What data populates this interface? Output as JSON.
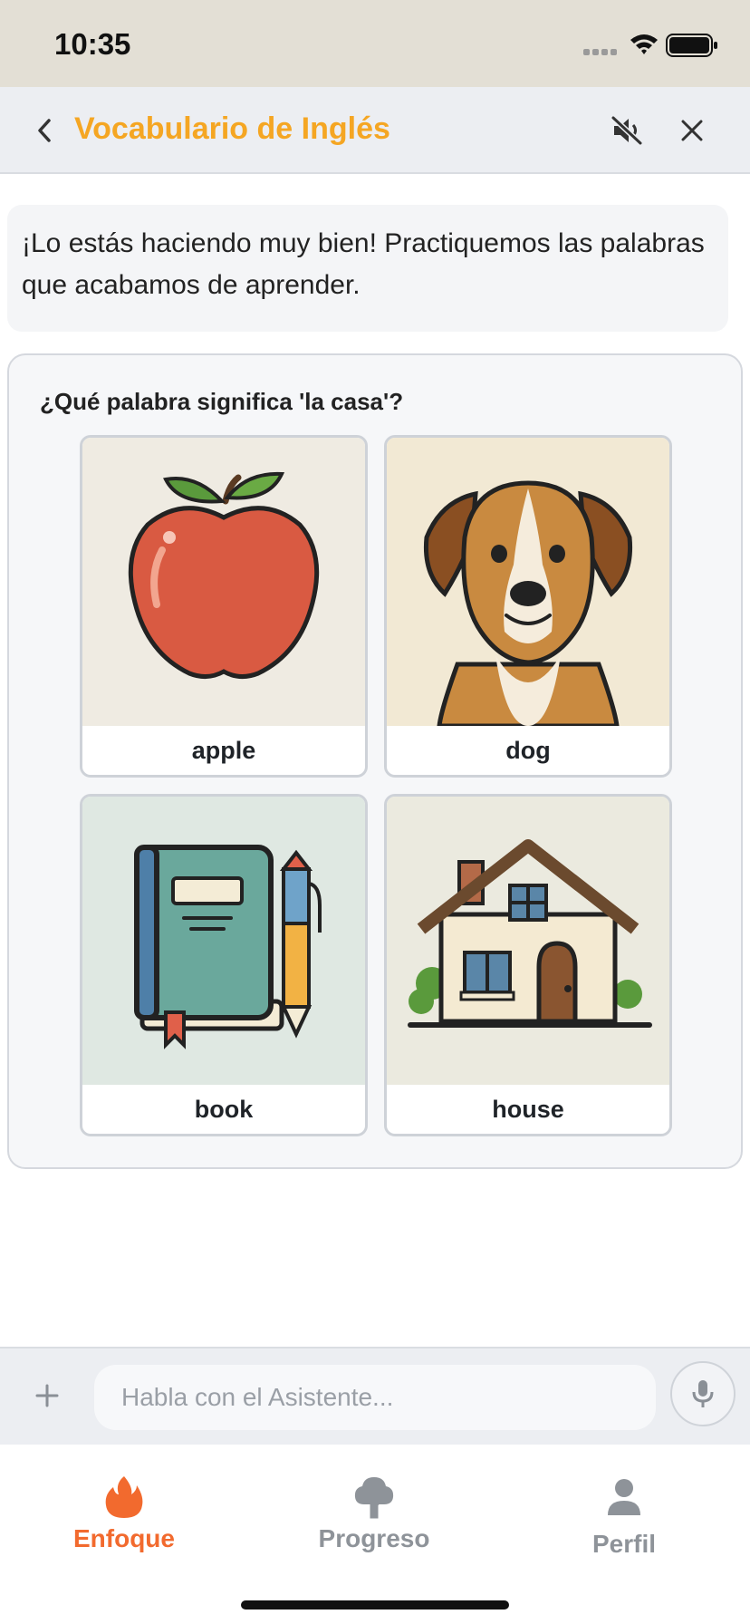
{
  "status_bar": {
    "time": "10:35"
  },
  "header": {
    "title": "Vocabulario de Inglés",
    "back_icon": "chevron-left-icon",
    "mute_icon": "speaker-muted-icon",
    "close_icon": "close-icon"
  },
  "message": {
    "text": "¡Lo estás haciendo muy bien! Practiquemos las palabras que acabamos de aprender."
  },
  "quiz": {
    "question": "¿Qué palabra significa 'la casa'?",
    "options": [
      {
        "label": "apple",
        "image": "apple-illustration"
      },
      {
        "label": "dog",
        "image": "dog-illustration"
      },
      {
        "label": "book",
        "image": "book-illustration"
      },
      {
        "label": "house",
        "image": "house-illustration"
      }
    ]
  },
  "input": {
    "placeholder": "Habla con el Asistente...",
    "plus_icon": "plus-icon",
    "mic_icon": "microphone-icon"
  },
  "tabs": [
    {
      "label": "Enfoque",
      "icon": "flame-icon",
      "active": true,
      "color": "#f26a2e"
    },
    {
      "label": "Progreso",
      "icon": "tree-icon",
      "active": false,
      "color": "#8e9399"
    },
    {
      "label": "Perfil",
      "icon": "person-icon",
      "active": false,
      "color": "#8e9399"
    }
  ],
  "colors": {
    "accent": "#f5a623",
    "active_tab": "#f26a2e",
    "inactive_tab": "#8e9399"
  }
}
